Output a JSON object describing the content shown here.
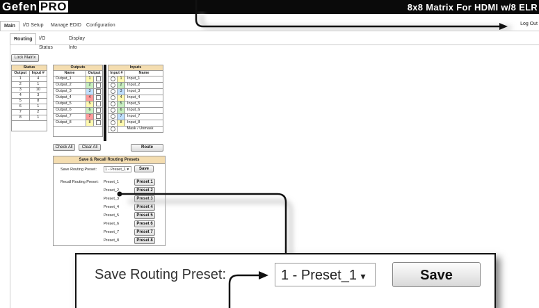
{
  "header": {
    "logo_brand": "Gefen",
    "logo_pro": "PRO",
    "title": "8x8 Matrix For HDMI w/8 ELR"
  },
  "main_tabs": [
    "Main",
    "I/O Setup",
    "Manage EDID",
    "Configuration"
  ],
  "logout": "Log Out",
  "sub_tabs": [
    "Routing",
    "I/O Status",
    "Display Info"
  ],
  "lock_button": "Lock Matrix",
  "status": {
    "title": "Status",
    "cols": [
      "Output",
      "Input #"
    ],
    "rows": [
      [
        "1",
        "4"
      ],
      [
        "2",
        "1"
      ],
      [
        "3",
        "10"
      ],
      [
        "4",
        "3"
      ],
      [
        "5",
        "8"
      ],
      [
        "6",
        "1"
      ],
      [
        "7",
        "2"
      ],
      [
        "8",
        "1"
      ]
    ]
  },
  "outputs": {
    "title": "Outputs",
    "cols": [
      "Name",
      "Output"
    ],
    "rows": [
      [
        "Output_1",
        "1"
      ],
      [
        "Output_2",
        "2"
      ],
      [
        "Output_3",
        "3"
      ],
      [
        "Output_4",
        "4"
      ],
      [
        "Output_5",
        "5"
      ],
      [
        "Output_6",
        "6"
      ],
      [
        "Output_7",
        "7"
      ],
      [
        "Output_8",
        "8"
      ]
    ],
    "colors": [
      "#fffab0",
      "#c8f0c0",
      "#bfe0ff",
      "#ff9a9a",
      "#fffab0",
      "#c8f0c0",
      "#ff9a9a",
      "#fffab0"
    ]
  },
  "inputs": {
    "title": "Inputs",
    "cols": [
      "Input #",
      "Name"
    ],
    "rows": [
      [
        "1",
        "Input_1"
      ],
      [
        "2",
        "Input_2"
      ],
      [
        "3",
        "Input_3"
      ],
      [
        "4",
        "Input_4"
      ],
      [
        "5",
        "Input_5"
      ],
      [
        "6",
        "Input_6"
      ],
      [
        "7",
        "Input_7"
      ],
      [
        "8",
        "Input_8"
      ]
    ],
    "mask": "Mask / Unmask",
    "colors": [
      "#fffab0",
      "#c8f0c0",
      "#bfe0ff",
      "#fffab0",
      "#c8f0c0",
      "#c8f0c0",
      "#bfe0ff",
      "#fffab0"
    ]
  },
  "check_all": "Check All",
  "clear_all": "Clear All",
  "route": "Route",
  "presets_panel": {
    "title": "Save & Recall Routing Presets",
    "save_label": "Save Routing Preset:",
    "selected": "1 - Preset_1",
    "save_button": "Save",
    "recall_label": "Recall Routing Preset:",
    "presets": [
      [
        "Preset_1",
        "Preset 1"
      ],
      [
        "Preset_2",
        "Preset 2"
      ],
      [
        "Preset_3",
        "Preset 3"
      ],
      [
        "Preset_4",
        "Preset 4"
      ],
      [
        "Preset_5",
        "Preset 5"
      ],
      [
        "Preset_6",
        "Preset 6"
      ],
      [
        "Preset_7",
        "Preset 7"
      ],
      [
        "Preset_8",
        "Preset 8"
      ]
    ]
  },
  "zoom": {
    "label": "Save Routing Preset:",
    "selected": "1 - Preset_1",
    "save": "Save"
  }
}
